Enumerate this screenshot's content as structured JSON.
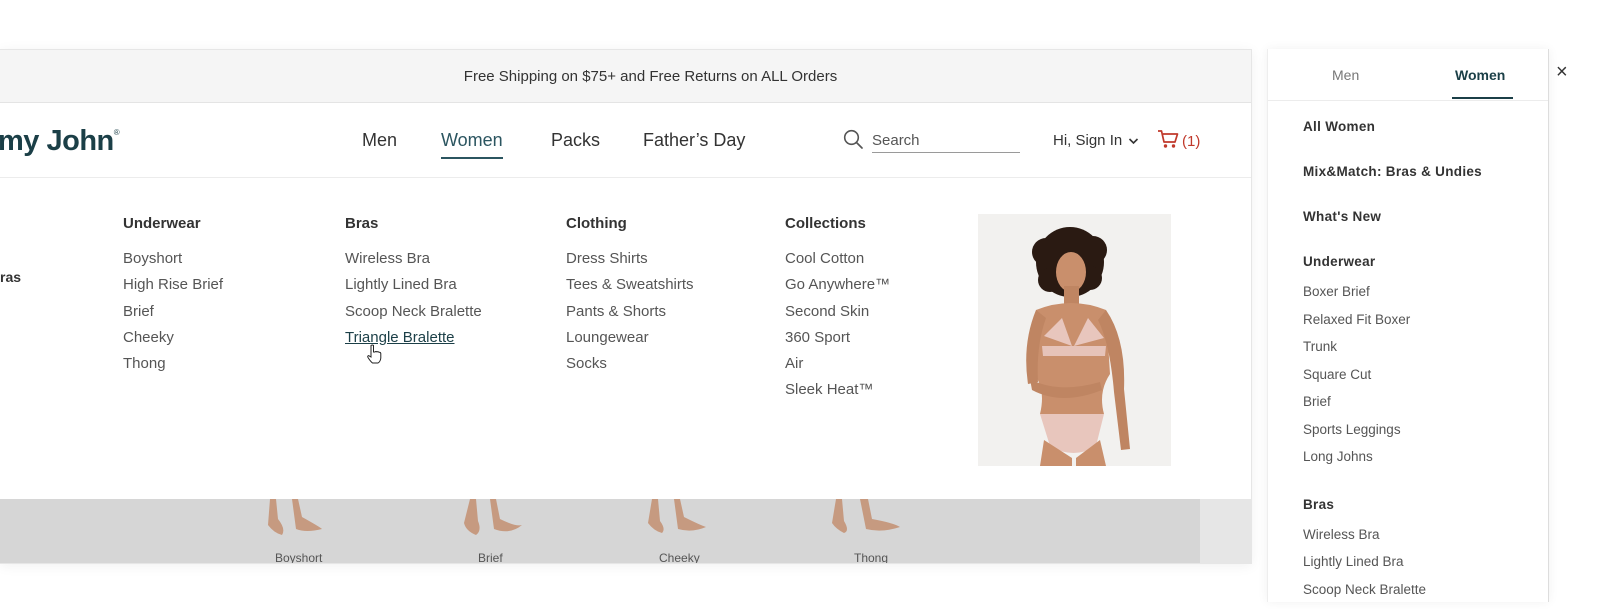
{
  "promo_bar": {
    "text": "Free Shipping on $75+ and Free Returns on ALL Orders"
  },
  "header": {
    "logo_text": "my John",
    "nav": [
      {
        "label": "Men"
      },
      {
        "label": "Women",
        "active": true
      },
      {
        "label": "Packs"
      },
      {
        "label": "Father’s Day"
      }
    ],
    "search_placeholder": "Search",
    "signin_label": "Hi, Sign In",
    "cart_label": "(1)"
  },
  "mega_menu": {
    "left_fragment": "ras",
    "columns": [
      {
        "title": "Underwear",
        "items": [
          "Boyshort",
          "High Rise Brief",
          "Brief",
          "Cheeky",
          "Thong"
        ]
      },
      {
        "title": "Bras",
        "items": [
          "Wireless Bra",
          "Lightly Lined Bra",
          "Scoop Neck Bralette",
          "Triangle Bralette"
        ],
        "hovered": "Triangle Bralette"
      },
      {
        "title": "Clothing",
        "items": [
          "Dress Shirts",
          "Tees & Sweatshirts",
          "Pants & Shorts",
          "Loungewear",
          "Socks"
        ]
      },
      {
        "title": "Collections",
        "items": [
          "Cool Cotton",
          "Go Anywhere™",
          "Second Skin",
          "360 Sport",
          "Air",
          "Sleek Heat™"
        ]
      }
    ],
    "promo_image": "model-in-pink-bralette"
  },
  "product_strip": {
    "items": [
      "Boyshort",
      "Brief",
      "Cheeky",
      "Thong"
    ]
  },
  "drawer": {
    "tabs": [
      {
        "label": "Men"
      },
      {
        "label": "Women",
        "active": true
      }
    ],
    "top_items": [
      "All Women",
      "Mix&Match: Bras & Undies",
      "What's New"
    ],
    "sections": [
      {
        "title": "Underwear",
        "items": [
          "Boxer Brief",
          "Relaxed Fit Boxer",
          "Trunk",
          "Square Cut",
          "Brief",
          "Sports Leggings",
          "Long Johns"
        ]
      },
      {
        "title": "Bras",
        "items": [
          "Wireless Bra",
          "Lightly Lined Bra",
          "Scoop Neck Bralette"
        ]
      }
    ],
    "close_icon": "×"
  },
  "colors": {
    "brand": "#1b3f47",
    "cart": "#c0392b",
    "promo_bg": "#f5f5f5",
    "strip_bg": "#d6d6d6"
  }
}
